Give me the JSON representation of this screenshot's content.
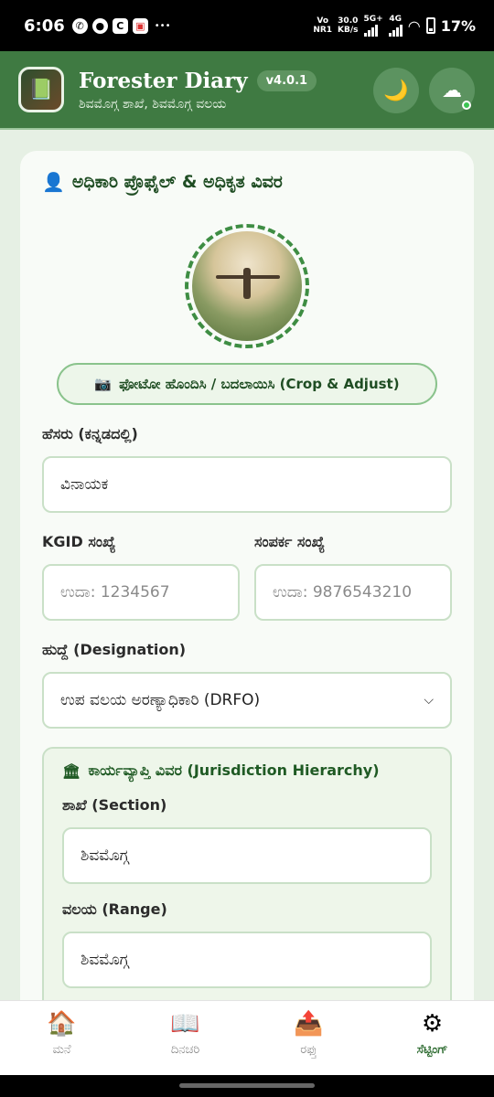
{
  "status_bar": {
    "time": "6:06",
    "net_top": "Vo",
    "net_bottom": "NR1",
    "speed_top": "30.0",
    "speed_bottom": "KB/s",
    "net5g": "5G+",
    "net4g": "4G",
    "battery": "17%"
  },
  "header": {
    "title": "Forester Diary",
    "version": "v4.0.1",
    "subtitle": "ಶಿವಮೊಗ್ಗ ಶಾಖೆ, ಶಿವಮೊಗ್ಗ ವಲಯ",
    "theme_icon": "moon-icon",
    "sync_icon": "cloud-icon"
  },
  "profile": {
    "section_title": "ಅಧಿಕಾರಿ ಪ್ರೊಫೈಲ್ & ಅಧಿಕೃತ ವಿವರ",
    "photo_button": "ಫೋಟೋ ಹೊಂದಿಸಿ / ಬದಲಾಯಿಸಿ (Crop & Adjust)",
    "name_label": "ಹೆಸರು (ಕನ್ನಡದಲ್ಲಿ)",
    "name_value": "ವಿನಾಯಕ",
    "kgid_label": "KGID ಸಂಖ್ಯೆ",
    "kgid_placeholder": "ಉದಾ: 1234567",
    "contact_label": "ಸಂಪರ್ಕ ಸಂಖ್ಯೆ",
    "contact_placeholder": "ಉದಾ: 9876543210",
    "designation_label": "ಹುದ್ದೆ (Designation)",
    "designation_value": "ಉಪ ವಲಯ ಅರಣ್ಯಾಧಿಕಾರಿ (DRFO)"
  },
  "jurisdiction": {
    "title": "ಕಾರ್ಯವ್ಯಾಪ್ತಿ ವಿವರ (Jurisdiction Hierarchy)",
    "section_label": "ಶಾಖೆ (Section)",
    "section_value": "ಶಿವಮೊಗ್ಗ",
    "range_label": "ವಲಯ (Range)",
    "range_value": "ಶಿವಮೊಗ್ಗ"
  },
  "nav": {
    "home": "ಮನೆ",
    "diary": "ದಿನಚರಿ",
    "export": "ರಫ್ತು",
    "settings": "ಸೆಟ್ಟಿಂಗ್"
  }
}
